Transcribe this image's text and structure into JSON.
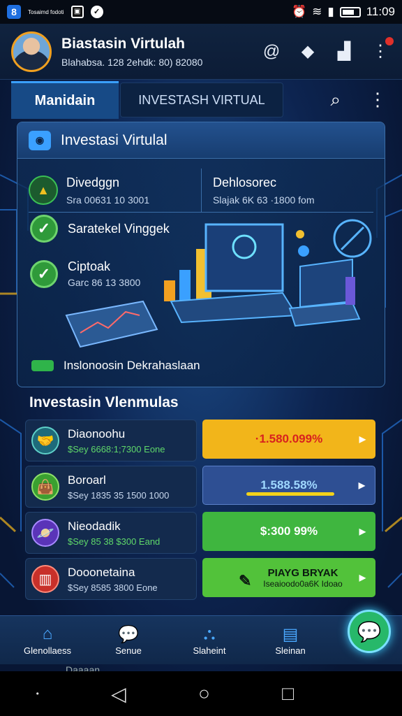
{
  "status_bar": {
    "left_text": "Tosaimd\nfodoti",
    "time": "11:09"
  },
  "header": {
    "title": "Biastasin Virtulah",
    "subtitle": "Blahabsa. 128 2ehdk: 80) 82080"
  },
  "tabs": {
    "active": "Manidain",
    "second": "INVESTASH VIRTUAL"
  },
  "card": {
    "title": "Investasi Virtulal",
    "stats": [
      {
        "title": "Divedggn",
        "sub": "Sra 00631 10 3001"
      },
      {
        "title": "Dehlosorec",
        "sub": "Slajak 6K 63 ·1800 fom"
      }
    ],
    "checks": [
      {
        "title": "Saratekel Vinggek",
        "sub": ""
      },
      {
        "title": "Ciptoak",
        "sub": "Garc 86 13 3800"
      }
    ],
    "footer": "Inslonoosin Dekrahaslaan"
  },
  "list": {
    "title": "Investasin Vlenmulas",
    "rows": [
      {
        "name": "Diaonoohu",
        "sub": "$Sey 6668:1;7300 Eone",
        "value": "·1.580.099%",
        "icon": "handshake-icon",
        "right_color": "#f2b51a",
        "text_color": "#d8221e"
      },
      {
        "name": "Boroarl",
        "sub": "$Sey 1835 35 1500 1000",
        "value": "1.588.58%",
        "icon": "bag-icon",
        "right_color": "#2e4f93",
        "text_color": "#9fd8ff"
      },
      {
        "name": "Nieodadik",
        "sub": "$Sey 85 38 $300 Eand",
        "value": "$:300 99%",
        "icon": "planet-icon",
        "right_color": "#3fb63f",
        "text_color": "#ffffff"
      },
      {
        "name": "Dooonetaina",
        "sub": "$Sey 8585 3800 Eone",
        "value": "PIAYG BRYAK",
        "value2": "Iseaioodo0a6K Idoao",
        "icon": "store-icon",
        "right_color": "#52c23a",
        "text_color": "#0b1a10"
      }
    ]
  },
  "bottom_nav": {
    "items": [
      "Glenollaess",
      "Senue",
      "Slaheint",
      "Sleinan"
    ]
  },
  "peek_text": "Daaaan"
}
